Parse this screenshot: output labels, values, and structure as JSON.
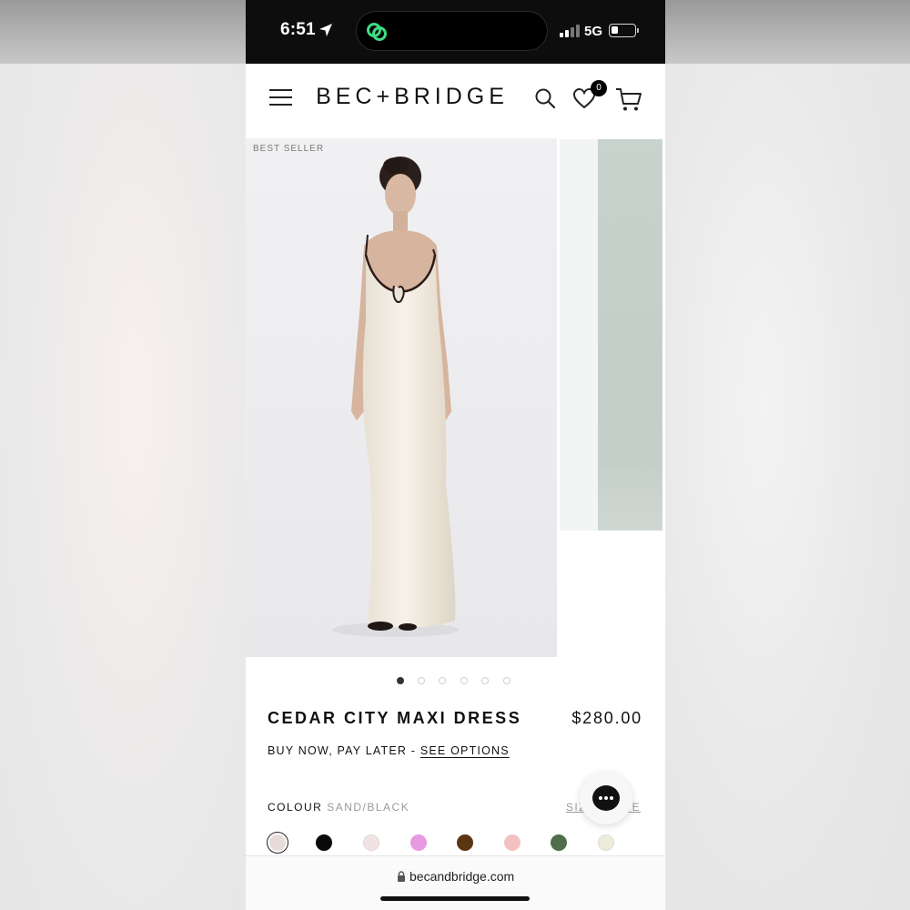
{
  "status_bar": {
    "time": "6:51",
    "network": "5G"
  },
  "header": {
    "brand": "BEC+BRIDGE",
    "wishlist_count": "0"
  },
  "gallery": {
    "badge": "BEST SELLER",
    "slide_count": 6,
    "active_slide": 1
  },
  "product": {
    "name": "CEDAR CITY MAXI DRESS",
    "price": "$280.00",
    "bnpl_text": "BUY NOW, PAY LATER - ",
    "bnpl_link": "SEE OPTIONS",
    "colour_label": "COLOUR",
    "colour_name": "SAND/BLACK",
    "size_guide": "SIZE GUIDE",
    "swatches": [
      "#e8dcd8",
      "#0a0a0a",
      "#f1e3e3",
      "#e79ae0",
      "#5b3512",
      "#f3c2c0",
      "#4f6e4a",
      "#ecebdc"
    ]
  },
  "browser": {
    "url": "becandbridge.com"
  },
  "icons": [
    "location-arrow-icon",
    "app-link-icon",
    "signal-icon",
    "battery-icon",
    "menu-icon",
    "search-icon",
    "heart-icon",
    "cart-icon",
    "chat-icon",
    "lock-icon"
  ]
}
